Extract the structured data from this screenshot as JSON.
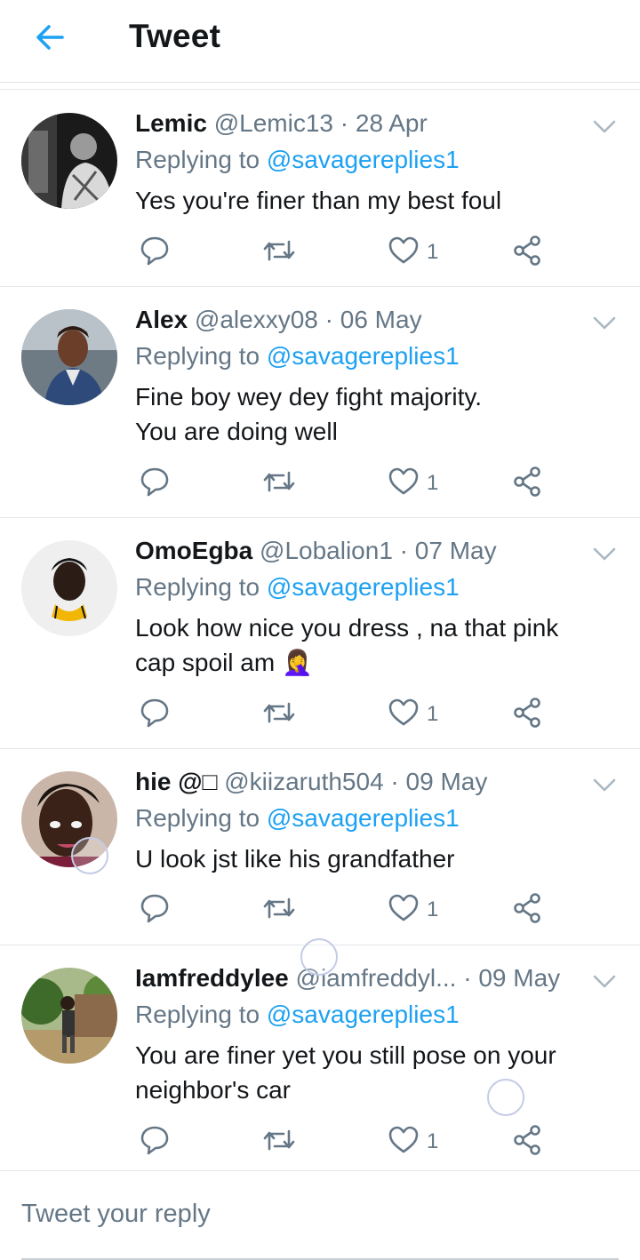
{
  "header": {
    "title": "Tweet",
    "back_icon": "back-arrow-icon"
  },
  "colors": {
    "accent": "#1da1f2",
    "muted": "#657786",
    "text": "#14171a",
    "divider": "#e1e6ea"
  },
  "replies": [
    {
      "name": "Lemic",
      "handle": "@Lemic13",
      "date": "· 28 Apr",
      "replying_prefix": "Replying to",
      "replying_to": "@savagereplies1",
      "text": "Yes you're finer than my best foul",
      "likes": "1"
    },
    {
      "name": "Alex",
      "handle": "@alexxy08",
      "date": "· 06 May",
      "replying_prefix": "Replying to",
      "replying_to": "@savagereplies1",
      "text_line1": "Fine boy wey dey fight majority.",
      "text_line2": "You are doing well",
      "likes": "1"
    },
    {
      "name": "OmoEgba",
      "handle": "@Lobalion1",
      "date": "· 07 May",
      "replying_prefix": "Replying to",
      "replying_to": "@savagereplies1",
      "text_line1": "Look how nice you dress , na that pink",
      "text_line2": "cap spoil am 🤦‍♀️",
      "likes": "1"
    },
    {
      "name": "hie @□",
      "handle": "@kiizaruth504",
      "date": "· 09 May",
      "replying_prefix": "Replying to",
      "replying_to": "@savagereplies1",
      "text": "U look jst like his grandfather",
      "likes": "1"
    },
    {
      "name": "Iamfreddylee",
      "handle": "@iamfreddyl...",
      "date": "· 09 May",
      "replying_prefix": "Replying to",
      "replying_to": "@savagereplies1",
      "text_line1": "You are finer yet you still pose on your",
      "text_line2": "neighbor's car",
      "likes": "1"
    }
  ],
  "compose": {
    "placeholder": "Tweet your reply"
  }
}
